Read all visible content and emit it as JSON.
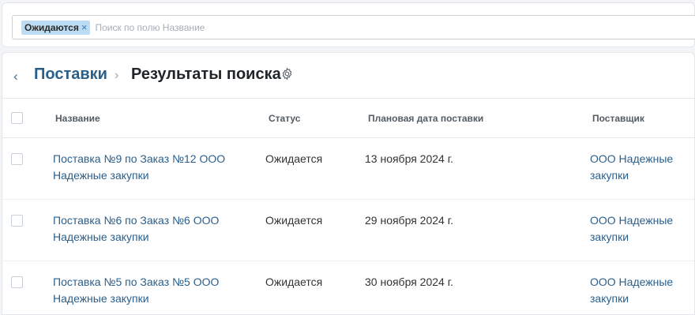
{
  "search": {
    "filter_chip": "Ожидаются",
    "chip_close": "×",
    "placeholder": "Поиск по полю Название",
    "value": ""
  },
  "header": {
    "back_symbol": "‹",
    "breadcrumb_parent": "Поставки",
    "separator": "›",
    "title": "Результаты поиска",
    "settings_icon": "gear-icon"
  },
  "table": {
    "columns": [
      "Название",
      "Статус",
      "Плановая дата поставки",
      "Поставщик"
    ],
    "rows": [
      {
        "name_line1": "Поставка №9 по Заказ №12 ООО",
        "name_line2": "Надежные закупки",
        "status": "Ожидается",
        "date": "13 ноября 2024 г.",
        "supplier_line1": "ООО Надежные",
        "supplier_line2": "закупки"
      },
      {
        "name_line1": "Поставка №6 по Заказ №6 ООО",
        "name_line2": "Надежные закупки",
        "status": "Ожидается",
        "date": "29 ноября 2024 г.",
        "supplier_line1": "ООО Надежные",
        "supplier_line2": "закупки"
      },
      {
        "name_line1": "Поставка №5 по Заказ №5 ООО",
        "name_line2": "Надежные закупки",
        "status": "Ожидается",
        "date": "30 ноября 2024 г.",
        "supplier_line1": "ООО Надежные",
        "supplier_line2": "закупки"
      }
    ]
  },
  "colors": {
    "link": "#2a5f8c",
    "chip_bg": "#bcdcf3",
    "border": "#e6e9ec"
  }
}
